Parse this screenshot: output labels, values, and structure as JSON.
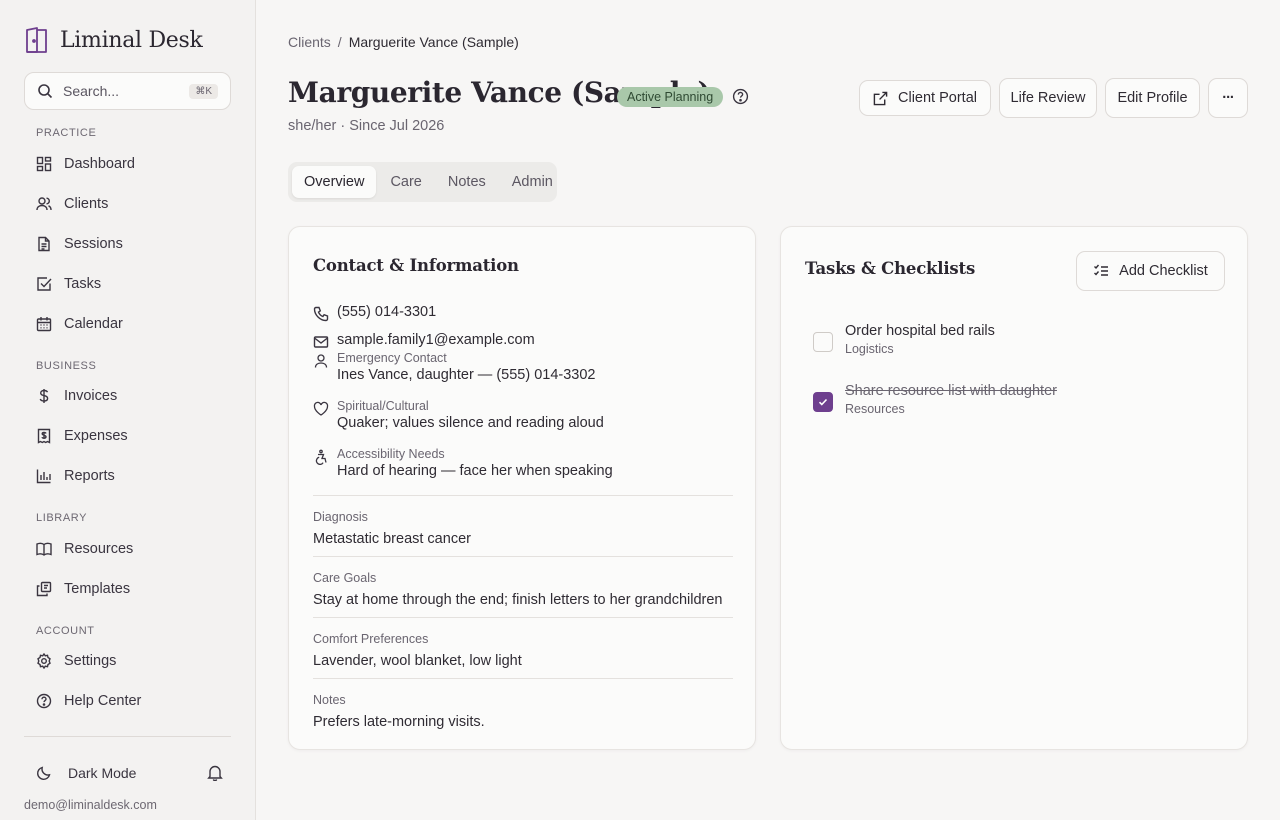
{
  "sidebar": {
    "brand": "Liminal Desk",
    "search_placeholder": "Search...",
    "search_shortcut": "⌘K",
    "sections": {
      "practice": "PRACTICE",
      "business": "BUSINESS",
      "library": "LIBRARY",
      "account": "ACCOUNT"
    },
    "items": {
      "dashboard": "Dashboard",
      "clients": "Clients",
      "sessions": "Sessions",
      "tasks": "Tasks",
      "calendar": "Calendar",
      "invoices": "Invoices",
      "expenses": "Expenses",
      "reports": "Reports",
      "resources": "Resources",
      "templates": "Templates",
      "settings": "Settings",
      "help": "Help Center"
    },
    "dark_mode": "Dark Mode",
    "user_email": "demo@liminaldesk.com"
  },
  "breadcrumb": {
    "parent": "Clients",
    "separator": "/",
    "current": "Marguerite Vance (Sample)"
  },
  "header": {
    "title": "Marguerite Vance (Sample)",
    "status": "Active Planning",
    "subtitle": "she/her · Since Jul 2026",
    "buttons": {
      "portal": "Client Portal",
      "life_review": "Life Review",
      "edit": "Edit Profile",
      "more": "···"
    }
  },
  "tabs": [
    "Overview",
    "Care",
    "Notes",
    "Admin"
  ],
  "contact": {
    "title": "Contact & Information",
    "phone": "(555) 014-3301",
    "email": "sample.family1@example.com",
    "emergency_label": "Emergency Contact",
    "emergency_value": "Ines Vance, daughter — (555) 014-3302",
    "spiritual_label": "Spiritual/Cultural",
    "spiritual_value": "Quaker; values silence and reading aloud",
    "access_label": "Accessibility Needs",
    "access_value": "Hard of hearing — face her when speaking",
    "diagnosis_label": "Diagnosis",
    "diagnosis_value": "Metastatic breast cancer",
    "goals_label": "Care Goals",
    "goals_value": "Stay at home through the end; finish letters to her grandchildren",
    "comfort_label": "Comfort Preferences",
    "comfort_value": "Lavender, wool blanket, low light",
    "notes_label": "Notes",
    "notes_value": "Prefers late-morning visits."
  },
  "tasks": {
    "title": "Tasks & Checklists",
    "add_button": "Add Checklist",
    "items": [
      {
        "title": "Order hospital bed rails",
        "category": "Logistics",
        "done": false
      },
      {
        "title": "Share resource list with daughter",
        "category": "Resources",
        "done": true
      }
    ]
  },
  "colors": {
    "accent": "#6e3f8e",
    "badge_bg": "#a9c8aa"
  }
}
